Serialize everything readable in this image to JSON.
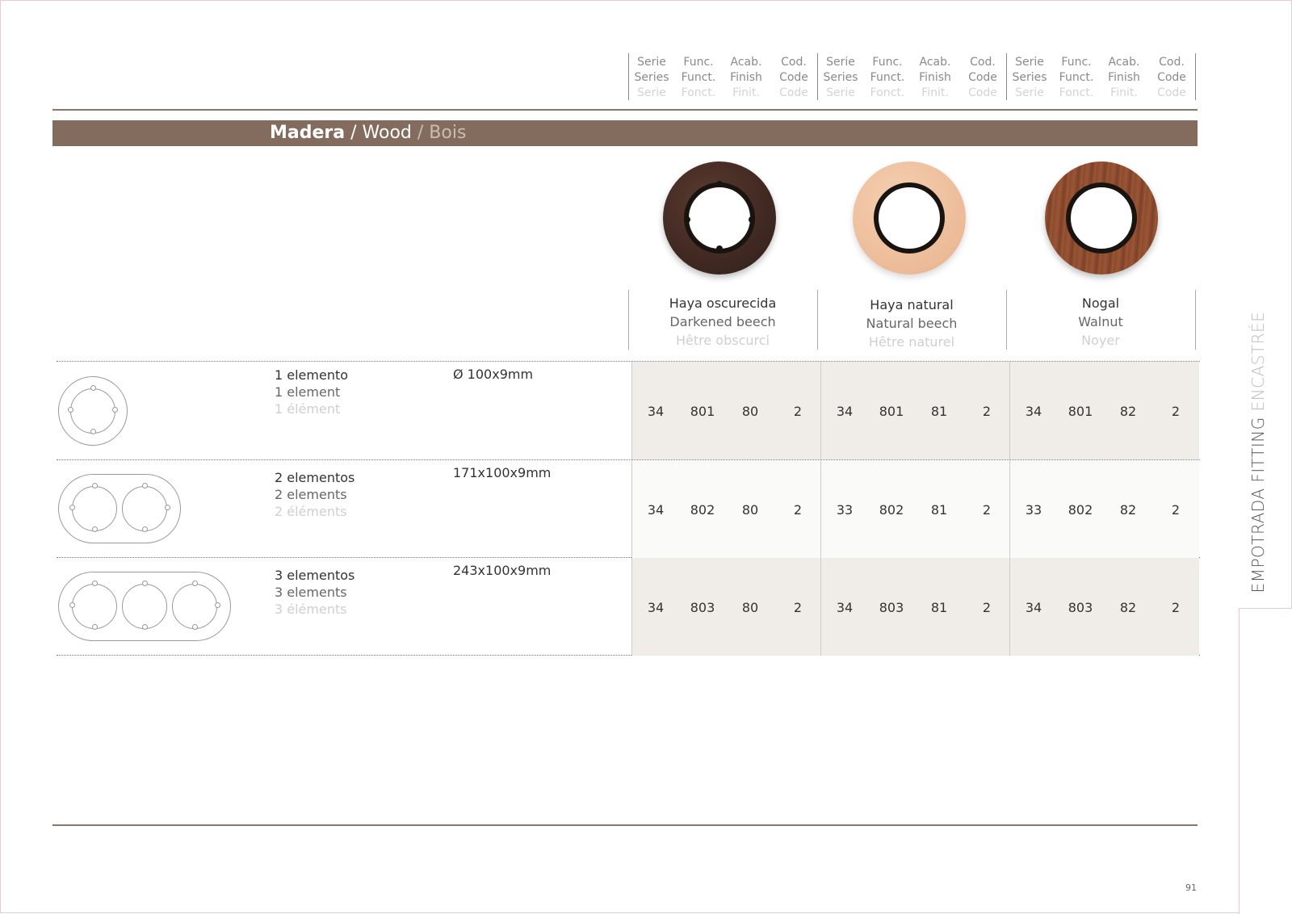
{
  "side_tab": {
    "dark": "EMPOTRADA FITTING",
    "light": " ENCASTRÉE"
  },
  "column_header": {
    "serie": [
      "Serie",
      "Series",
      "Serie"
    ],
    "func": [
      "Func.",
      "Funct.",
      "Fonct."
    ],
    "acab": [
      "Acab.",
      "Finish",
      "Finit."
    ],
    "cod": [
      "Cod.",
      "Code",
      "Code"
    ]
  },
  "section": {
    "title_es": "Madera",
    "sep1": " / ",
    "title_en": "Wood",
    "sep2": " / ",
    "title_fr": "Bois"
  },
  "finishes": [
    {
      "es": "Haya oscurecida",
      "en": "Darkened beech",
      "fr": "Hêtre obscurci"
    },
    {
      "es": "Haya natural",
      "en": "Natural beech",
      "fr": "Hêtre naturel"
    },
    {
      "es": "Nogal",
      "en": "Walnut",
      "fr": "Noyer"
    }
  ],
  "rows": [
    {
      "es": "1 elemento",
      "en": "1 element",
      "fr": "1 élément",
      "dim": "Ø 100x9mm",
      "codes": [
        [
          "34",
          "801",
          "80",
          "2"
        ],
        [
          "34",
          "801",
          "81",
          "2"
        ],
        [
          "34",
          "801",
          "82",
          "2"
        ]
      ]
    },
    {
      "es": "2 elementos",
      "en": "2 elements",
      "fr": "2 éléments",
      "dim": "171x100x9mm",
      "codes": [
        [
          "34",
          "802",
          "80",
          "2"
        ],
        [
          "33",
          "802",
          "81",
          "2"
        ],
        [
          "33",
          "802",
          "82",
          "2"
        ]
      ]
    },
    {
      "es": "3 elementos",
      "en": "3 elements",
      "fr": "3 éléments",
      "dim": "243x100x9mm",
      "codes": [
        [
          "34",
          "803",
          "80",
          "2"
        ],
        [
          "34",
          "803",
          "81",
          "2"
        ],
        [
          "34",
          "803",
          "82",
          "2"
        ]
      ]
    }
  ],
  "page_number": "91",
  "colors": {
    "band": "#836c5d",
    "shaded_cell": "#f0ece7",
    "rule": "#8a7668"
  }
}
